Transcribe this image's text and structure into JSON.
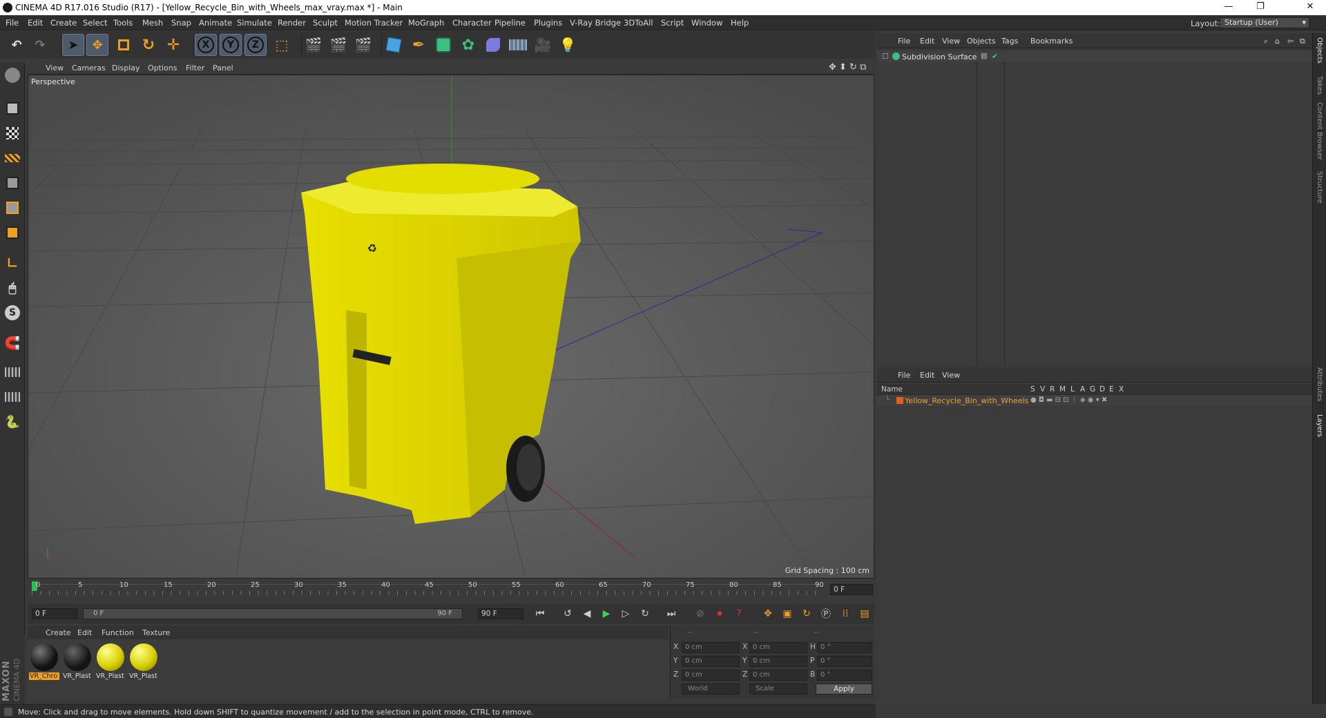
{
  "window": {
    "title": "CINEMA 4D R17.016 Studio (R17) - [Yellow_Recycle_Bin_with_Wheels_max_vray.max *] - Main",
    "minimize": "—",
    "restore": "❐",
    "close": "✕"
  },
  "menu": [
    "File",
    "Edit",
    "Create",
    "Select",
    "Tools",
    "Mesh",
    "Snap",
    "Animate",
    "Simulate",
    "Render",
    "Sculpt",
    "Motion Tracker",
    "MoGraph",
    "Character",
    "Pipeline",
    "Plugins",
    "V-Ray Bridge",
    "3DToAll",
    "Script",
    "Window",
    "Help"
  ],
  "layout": {
    "label": "Layout:",
    "value": "Startup (User)"
  },
  "toolbar": {
    "undo": "↶",
    "redo": "↷",
    "x_axis": "X",
    "y_axis": "Y",
    "z_axis": "Z"
  },
  "viewport": {
    "menu": [
      "View",
      "Cameras",
      "Display",
      "Options",
      "Filter",
      "Panel"
    ],
    "label": "Perspective",
    "grid_spacing": "Grid Spacing : 100 cm"
  },
  "timeline": {
    "ticks": [
      "0",
      "5",
      "10",
      "15",
      "20",
      "25",
      "30",
      "35",
      "40",
      "45",
      "50",
      "55",
      "60",
      "65",
      "70",
      "75",
      "80",
      "85",
      "90"
    ],
    "current_frame": "0 F",
    "start_field": "0 F",
    "range_start": "0 F",
    "range_end": "90 F",
    "end_field": "90 F"
  },
  "materials": {
    "menu": [
      "Create",
      "Edit",
      "Function",
      "Texture"
    ],
    "items": [
      {
        "name": "VR_Chro",
        "color": "#111111",
        "selected": true
      },
      {
        "name": "VR_Plast",
        "color": "#151515",
        "selected": false
      },
      {
        "name": "VR_Plast",
        "color": "#d8d000",
        "selected": false
      },
      {
        "name": "VR_Plast",
        "color": "#d8d000",
        "selected": false
      }
    ]
  },
  "coords": {
    "headers": [
      "--",
      "--",
      "--"
    ],
    "rows": [
      {
        "l1": "X",
        "v1": "0 cm",
        "l2": "X",
        "v2": "0 cm",
        "l3": "H",
        "v3": "0 °"
      },
      {
        "l1": "Y",
        "v1": "0 cm",
        "l2": "Y",
        "v2": "0 cm",
        "l3": "P",
        "v3": "0 °"
      },
      {
        "l1": "Z",
        "v1": "0 cm",
        "l2": "Z",
        "v2": "0 cm",
        "l3": "B",
        "v3": "0 °"
      }
    ],
    "world": "World",
    "scale": "Scale",
    "apply": "Apply"
  },
  "status": "Move: Click and drag to move elements. Hold down SHIFT to quantize movement / add to the selection in point mode, CTRL to remove.",
  "maxon": {
    "brand": "MAXON",
    "product": "CINEMA 4D"
  },
  "objects": {
    "menu": [
      "File",
      "Edit",
      "View",
      "Objects",
      "Tags",
      "Bookmarks"
    ],
    "item": "Subdivision Surface"
  },
  "side_tabs": [
    "Objects",
    "Takes",
    "Content Browser",
    "Structure",
    "Attributes",
    "Layers"
  ],
  "layers": {
    "menu": [
      "File",
      "Edit",
      "View"
    ],
    "headers": {
      "name": "Name",
      "cols": [
        "S",
        "V",
        "R",
        "M",
        "L",
        "A",
        "G",
        "D",
        "E",
        "X"
      ]
    },
    "item": "Yellow_Recycle_Bin_with_Wheels"
  },
  "colors": {
    "accent": "#4f5b6b",
    "bin": "#e6e000",
    "layer_text": "#f0a030"
  }
}
